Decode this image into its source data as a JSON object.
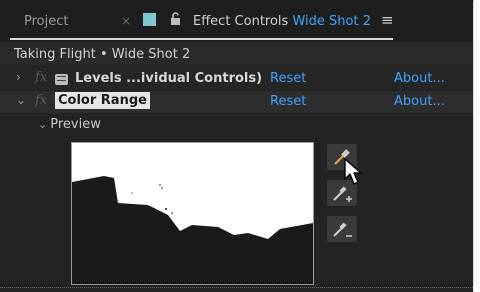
{
  "tabs": {
    "project_label": "Project",
    "close_glyph": "×",
    "effect_controls_prefix": "Effect Controls",
    "effect_controls_clip": "Wide Shot 2",
    "menu_glyph": "≡",
    "accent_color": "#3fa3ff"
  },
  "clip_title": "Taking Flight • Wide Shot 2",
  "effects": [
    {
      "name": "Levels ...ividual Controls)",
      "fx_label": "fx",
      "reset_label": "Reset",
      "about_label": "About...",
      "expanded": false
    },
    {
      "name": "Color Range",
      "fx_label": "fx",
      "reset_label": "Reset",
      "about_label": "About...",
      "expanded": true
    }
  ],
  "preview": {
    "label": "Preview"
  },
  "tools": [
    {
      "name": "eyedropper-icon"
    },
    {
      "name": "eyedropper-plus-icon"
    },
    {
      "name": "eyedropper-minus-icon"
    }
  ]
}
